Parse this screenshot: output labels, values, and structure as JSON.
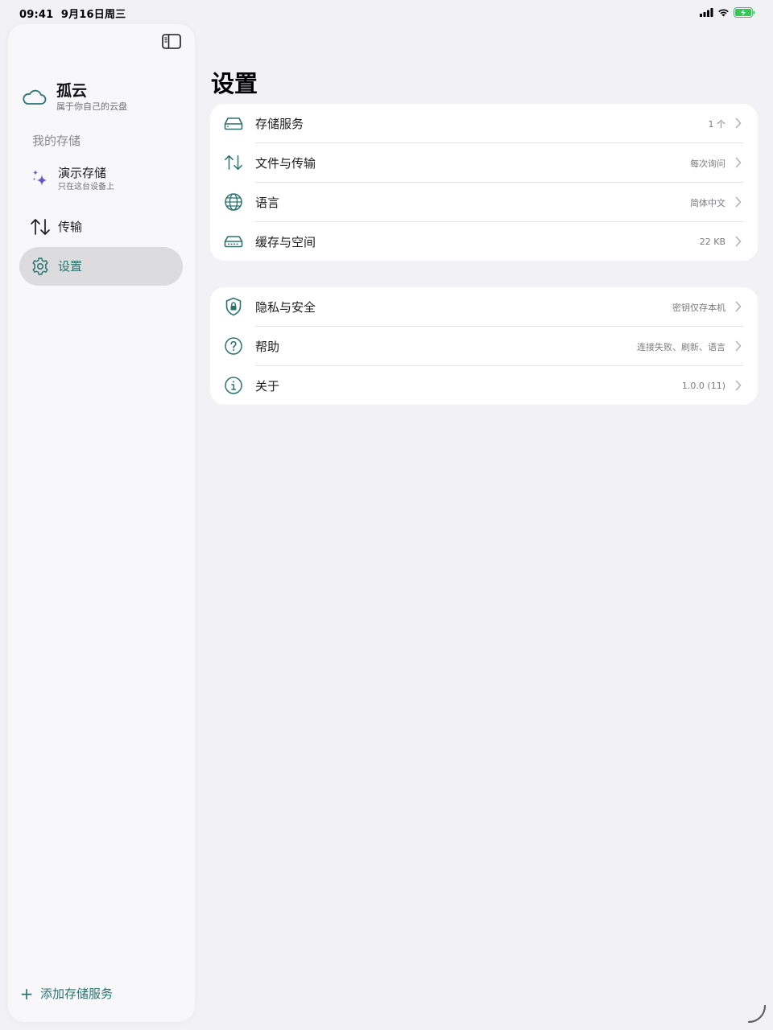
{
  "status_bar": {
    "time": "09:41",
    "date": "9月16日周三"
  },
  "sidebar": {
    "app_title": "孤云",
    "app_subtitle": "属于你自己的云盘",
    "section_label": "我的存储",
    "items": [
      {
        "label": "演示存储",
        "subtitle": "只在这台设备上"
      },
      {
        "label": "传输"
      },
      {
        "label": "设置"
      }
    ],
    "add_service_label": "添加存储服务"
  },
  "main": {
    "title": "设置",
    "groups": [
      {
        "rows": [
          {
            "label": "存储服务",
            "value": "1 个"
          },
          {
            "label": "文件与传输",
            "value": "每次询问"
          },
          {
            "label": "语言",
            "value": "简体中文"
          },
          {
            "label": "缓存与空间",
            "value": "22 KB"
          }
        ]
      },
      {
        "rows": [
          {
            "label": "隐私与安全",
            "value": "密钥仅存本机"
          },
          {
            "label": "帮助",
            "value": "连接失败、刷新、语言"
          },
          {
            "label": "关于",
            "value": "1.0.0 (11)"
          }
        ]
      }
    ]
  },
  "colors": {
    "accent": "#2b7270",
    "background": "#f2f1f6",
    "sparkle": "#6b55c9",
    "battery": "#34c759"
  },
  "icons": {
    "sidebar_toggle": "sidebar-toggle-icon",
    "app": "cloud-icon",
    "demo": "sparkles-icon",
    "transfer": "arrow-up-down-icon",
    "settings": "gear-icon",
    "storage_service": "hard-drive-icon",
    "file_transfer": "arrow-up-down-icon",
    "language": "globe-icon",
    "cache": "drive-icon",
    "privacy": "lock-shield-icon",
    "help": "question-circle-icon",
    "about": "info-circle-icon"
  }
}
